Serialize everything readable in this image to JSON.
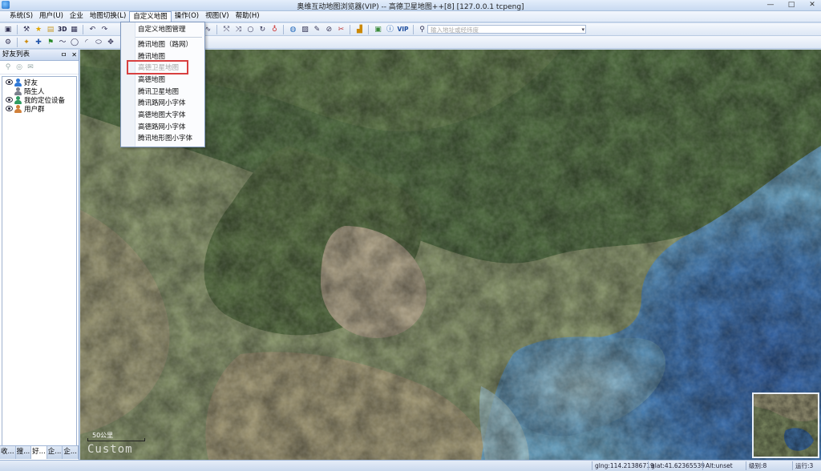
{
  "window": {
    "title": "奥维互动地图浏览器(VIP) -- 高德卫星地图++[8] [127.0.0.1 tcpeng]",
    "controls": [
      "—",
      "□",
      "✕"
    ]
  },
  "menubar": {
    "items": [
      "系统(S)",
      "用户(U)",
      "企业",
      "地图切换(L)",
      "自定义地图",
      "操作(O)",
      "视图(V)",
      "帮助(H)"
    ],
    "active_index": 4
  },
  "toolbar": {
    "label_3d": "3D",
    "label_vip": "VIP",
    "address_placeholder": "输入地址或经纬度"
  },
  "dropdown": {
    "items": [
      {
        "label": "自定义地图管理",
        "disabled": false
      },
      {
        "label": "腾讯地图（路网）",
        "disabled": false
      },
      {
        "label": "腾讯地图",
        "disabled": false
      },
      {
        "label": "高德卫星地图",
        "disabled": true
      },
      {
        "label": "高德地图",
        "disabled": false
      },
      {
        "label": "腾讯卫星地图",
        "disabled": false
      },
      {
        "label": "腾讯路网小字体",
        "disabled": false
      },
      {
        "label": "高德地图大字体",
        "disabled": false
      },
      {
        "label": "高德路网小字体",
        "disabled": false
      },
      {
        "label": "腾讯地形图小字体",
        "disabled": false
      }
    ]
  },
  "panel": {
    "title": "好友列表",
    "header_buttons": [
      "ㅁ",
      "✕"
    ],
    "tree": [
      {
        "label": "好友",
        "color": "#2f78d6"
      },
      {
        "label": "陌生人",
        "color": "#7a7f8c"
      },
      {
        "label": "我的定位设备",
        "color": "#2f9c62"
      },
      {
        "label": "用户群",
        "color": "#d0803a"
      }
    ],
    "tabs": [
      "收...",
      "搜...",
      "好...",
      "企...",
      "企..."
    ],
    "active_tab": 2
  },
  "map": {
    "scale_label": "50公里",
    "watermark": "Custom"
  },
  "status": {
    "lng": "glng:114.21386719",
    "lat": "glat:41.62365539",
    "alt": "Alt:unset",
    "level": "级别:8",
    "run": "运行:3"
  }
}
